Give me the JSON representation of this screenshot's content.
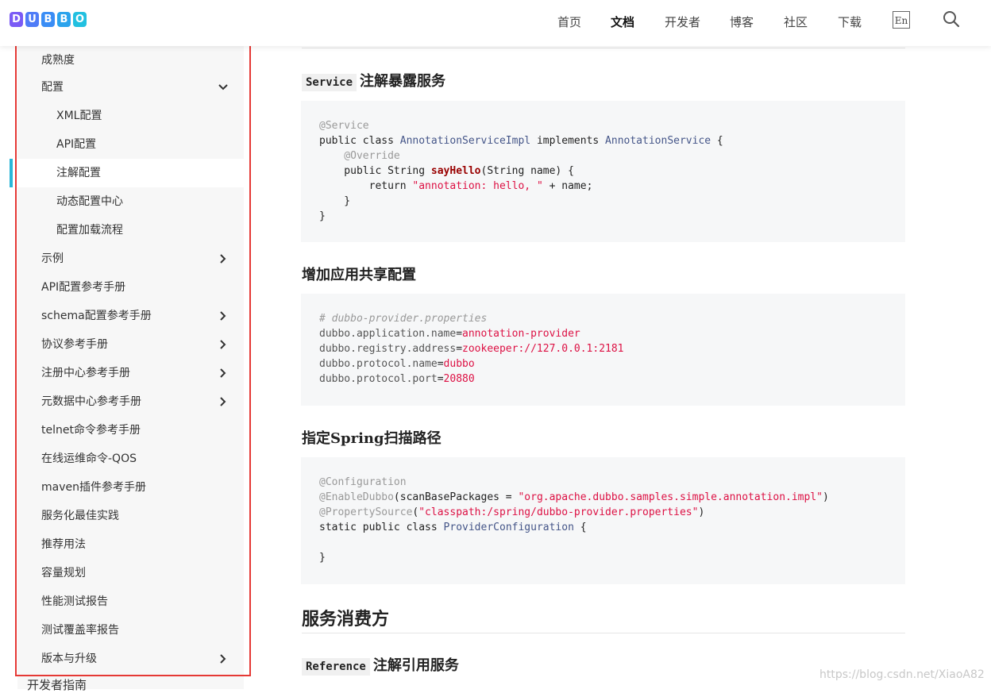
{
  "logo": {
    "letters": [
      "D",
      "U",
      "B",
      "B",
      "O"
    ],
    "colors": [
      "#7a5af5",
      "#4f7cf7",
      "#3a8df5",
      "#2ba3ec",
      "#22c0e0"
    ]
  },
  "nav": {
    "items": [
      "首页",
      "文档",
      "开发者",
      "博客",
      "社区",
      "下载"
    ],
    "lang": "En"
  },
  "sidebar": {
    "items": [
      {
        "label": "成熟度"
      },
      {
        "label": "配置"
      },
      {
        "label": "XML配置"
      },
      {
        "label": "API配置"
      },
      {
        "label": "注解配置"
      },
      {
        "label": "动态配置中心"
      },
      {
        "label": "配置加载流程"
      },
      {
        "label": "示例"
      },
      {
        "label": "API配置参考手册"
      },
      {
        "label": "schema配置参考手册"
      },
      {
        "label": "协议参考手册"
      },
      {
        "label": "注册中心参考手册"
      },
      {
        "label": "元数据中心参考手册"
      },
      {
        "label": "telnet命令参考手册"
      },
      {
        "label": "在线运维命令-QOS"
      },
      {
        "label": "maven插件参考手册"
      },
      {
        "label": "服务化最佳实践"
      },
      {
        "label": "推荐用法"
      },
      {
        "label": "容量规划"
      },
      {
        "label": "性能测试报告"
      },
      {
        "label": "测试覆盖率报告"
      },
      {
        "label": "版本与升级"
      }
    ],
    "cutoff": "开发者指南",
    "accent": "#2bb6d8"
  },
  "content": {
    "s1_code": "Service",
    "s1_title": "注解暴露服务",
    "s2_title": "增加应用共享配置",
    "s3_title": "指定Spring扫描路径",
    "h2": "服务消费方",
    "s4_code": "Reference",
    "s4_title": "注解引用服务",
    "code1": {
      "l1": "@Service",
      "l2a": "public class ",
      "l2b": "AnnotationServiceImpl",
      "l2c": " implements ",
      "l2d": "AnnotationService",
      "l2e": " {",
      "l3": "    @Override",
      "l4a": "    public String ",
      "l4b": "sayHello",
      "l4c": "(String name) {",
      "l5a": "        return ",
      "l5b": "\"annotation: hello, \"",
      "l5c": " + name;",
      "l6": "    }",
      "l7": "}"
    },
    "code2": {
      "l1": "# dubbo-provider.properties",
      "l2k": "dubbo.application.name",
      "l2v": "annotation-provider",
      "l3k": "dubbo.registry.address",
      "l3v": "zookeeper://127.0.0.1:2181",
      "l4k": "dubbo.protocol.name",
      "l4v": "dubbo",
      "l5k": "dubbo.protocol.port",
      "l5v": "20880",
      "eq": "="
    },
    "code3": {
      "l1": "@Configuration",
      "l2a": "@EnableDubbo",
      "l2b": "(scanBasePackages = ",
      "l2c": "\"org.apache.dubbo.samples.simple.annotation.impl\"",
      "l2d": ")",
      "l3a": "@PropertySource",
      "l3b": "(",
      "l3c": "\"classpath:/spring/dubbo-provider.properties\"",
      "l3d": ")",
      "l4a": "static public class ",
      "l4b": "ProviderConfiguration",
      "l4c": " {",
      "l6": "}"
    }
  },
  "watermark": "https://blog.csdn.net/XiaoA82"
}
